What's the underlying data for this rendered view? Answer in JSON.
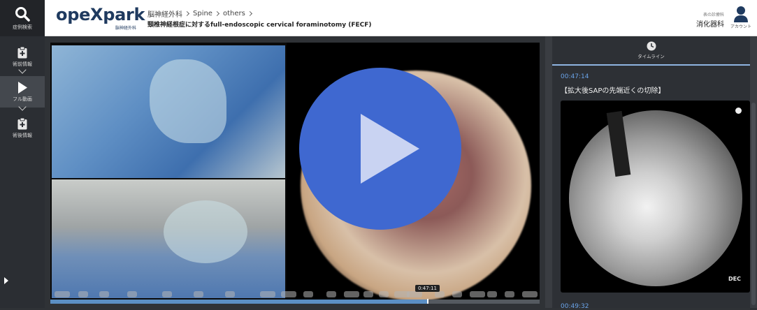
{
  "rail": {
    "search_label": "症例検索",
    "items": [
      {
        "label": "術前情報",
        "icon": "clipboard-plus-icon"
      },
      {
        "label": "フル動画",
        "icon": "play-icon"
      },
      {
        "label": "術後情報",
        "icon": "clipboard-plus-icon"
      }
    ]
  },
  "header": {
    "logo": "opeXpark",
    "logo_sub": "脳神経外科",
    "breadcrumb": [
      "脳神経外科",
      "Spine",
      "others"
    ],
    "title": "頸椎神経根症に対するfull-endoscopic cervical foraminotomy (FECF)",
    "dept_caption": "表の診療科",
    "dept": "消化器科",
    "account_label": "アカウント"
  },
  "player": {
    "tooltip_time": "0:47:11",
    "progress": 0.771
  },
  "timeline": {
    "tab_label": "タイムライン",
    "entries": [
      {
        "time": "00:47:14",
        "title": "【拡大後SAPの先端近くの切除】"
      },
      {
        "time": "00:49:32"
      }
    ],
    "thumb_label": "DEC"
  },
  "colors": {
    "accent": "#3f68d0",
    "timeline_time": "#6aa3e8",
    "logo": "#1f3a5f"
  }
}
